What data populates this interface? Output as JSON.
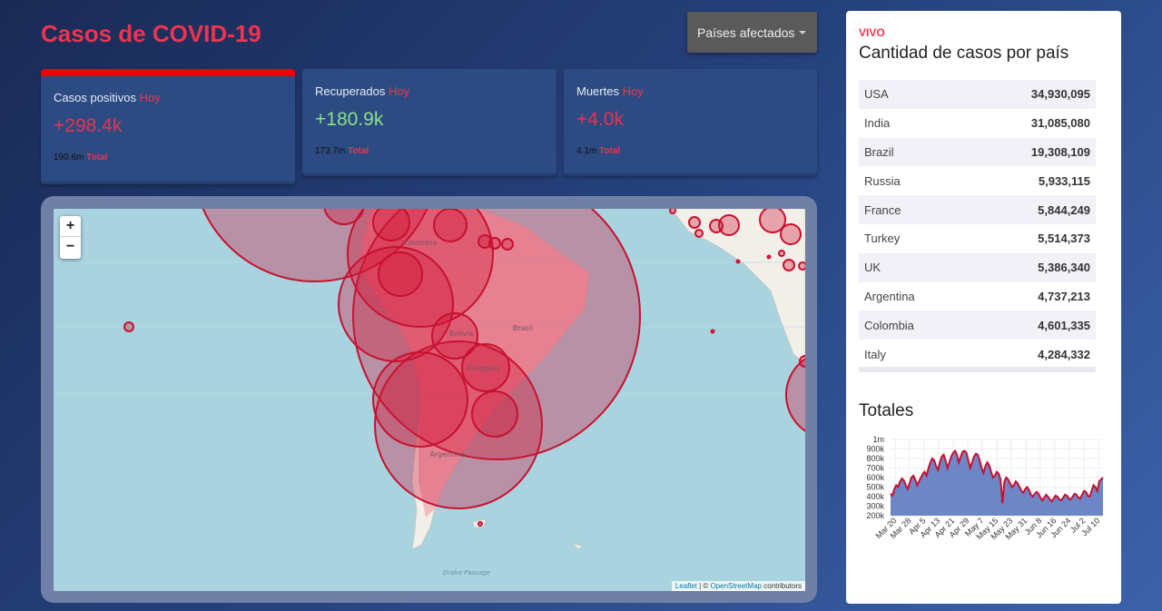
{
  "header": {
    "title": "Casos de COVID-19",
    "select_label": "Países afectados"
  },
  "cards": [
    {
      "label": "Casos positivos",
      "today": "Hoy",
      "value": "+298.4k",
      "value_color": "#e8334e",
      "total": "190.6m",
      "total_label": "Total"
    },
    {
      "label": "Recuperados",
      "today": "Hoy",
      "value": "+180.9k",
      "value_color": "#8be08b",
      "total": "173.7m",
      "total_label": "Total"
    },
    {
      "label": "Muertes",
      "today": "Hoy",
      "value": "+4.0k",
      "value_color": "#e8334e",
      "total": "4.1m",
      "total_label": "Total"
    }
  ],
  "map": {
    "zoom_in": "+",
    "zoom_out": "−",
    "labels": [
      "Colombia",
      "Bolivia",
      "Brasil",
      "Paraguay",
      "Argentina",
      "Drake Passage"
    ],
    "attribution": {
      "leaflet": "Leaflet",
      "sep": " | © ",
      "osm": "OpenStreetMap",
      "contrib": " contributors"
    },
    "circle_color": "#d0163a"
  },
  "sidepanel": {
    "live": "VIVO",
    "title": "Cantidad de casos por país",
    "countries": [
      {
        "name": "USA",
        "cases": "34,930,095"
      },
      {
        "name": "India",
        "cases": "31,085,080"
      },
      {
        "name": "Brazil",
        "cases": "19,308,109"
      },
      {
        "name": "Russia",
        "cases": "5,933,115"
      },
      {
        "name": "France",
        "cases": "5,844,249"
      },
      {
        "name": "Turkey",
        "cases": "5,514,373"
      },
      {
        "name": "UK",
        "cases": "5,386,340"
      },
      {
        "name": "Argentina",
        "cases": "4,737,213"
      },
      {
        "name": "Colombia",
        "cases": "4,601,335"
      },
      {
        "name": "Italy",
        "cases": "4,284,332"
      }
    ],
    "totals_title": "Totales"
  },
  "chart_data": {
    "type": "area",
    "ylim": [
      200000,
      1000000
    ],
    "yticks": [
      {
        "v": 200000,
        "t": "200k"
      },
      {
        "v": 300000,
        "t": "300k"
      },
      {
        "v": 400000,
        "t": "400k"
      },
      {
        "v": 500000,
        "t": "500k"
      },
      {
        "v": 600000,
        "t": "600k"
      },
      {
        "v": 700000,
        "t": "700k"
      },
      {
        "v": 800000,
        "t": "800k"
      },
      {
        "v": 900000,
        "t": "900k"
      },
      {
        "v": 1000000,
        "t": "1m"
      }
    ],
    "xticks": [
      "Mar 20",
      "Mar 28",
      "Apr 5",
      "Apr 13",
      "Apr 21",
      "Apr 29",
      "May 7",
      "May 15",
      "May 23",
      "May 31",
      "Jun 8",
      "Jun 16",
      "Jun 24",
      "Jul 2",
      "Jul 10"
    ],
    "values": [
      430000,
      410000,
      480000,
      520000,
      500000,
      560000,
      590000,
      570000,
      520000,
      480000,
      540000,
      600000,
      620000,
      580000,
      520000,
      560000,
      600000,
      640000,
      660000,
      620000,
      700000,
      760000,
      800000,
      780000,
      720000,
      680000,
      760000,
      820000,
      840000,
      780000,
      700000,
      760000,
      820000,
      860000,
      880000,
      840000,
      760000,
      820000,
      870000,
      880000,
      860000,
      780000,
      700000,
      760000,
      820000,
      850000,
      840000,
      780000,
      700000,
      650000,
      720000,
      760000,
      730000,
      660000,
      600000,
      620000,
      660000,
      640000,
      580000,
      330000,
      560000,
      600000,
      580000,
      540000,
      500000,
      520000,
      560000,
      540000,
      500000,
      460000,
      440000,
      480000,
      500000,
      470000,
      420000,
      400000,
      430000,
      450000,
      430000,
      390000,
      360000,
      390000,
      420000,
      400000,
      370000,
      350000,
      380000,
      410000,
      400000,
      370000,
      360000,
      390000,
      420000,
      410000,
      380000,
      370000,
      400000,
      430000,
      420000,
      390000,
      380000,
      420000,
      460000,
      450000,
      410000,
      400000,
      460000,
      520000,
      500000,
      460000,
      560000,
      580000,
      600000
    ]
  }
}
